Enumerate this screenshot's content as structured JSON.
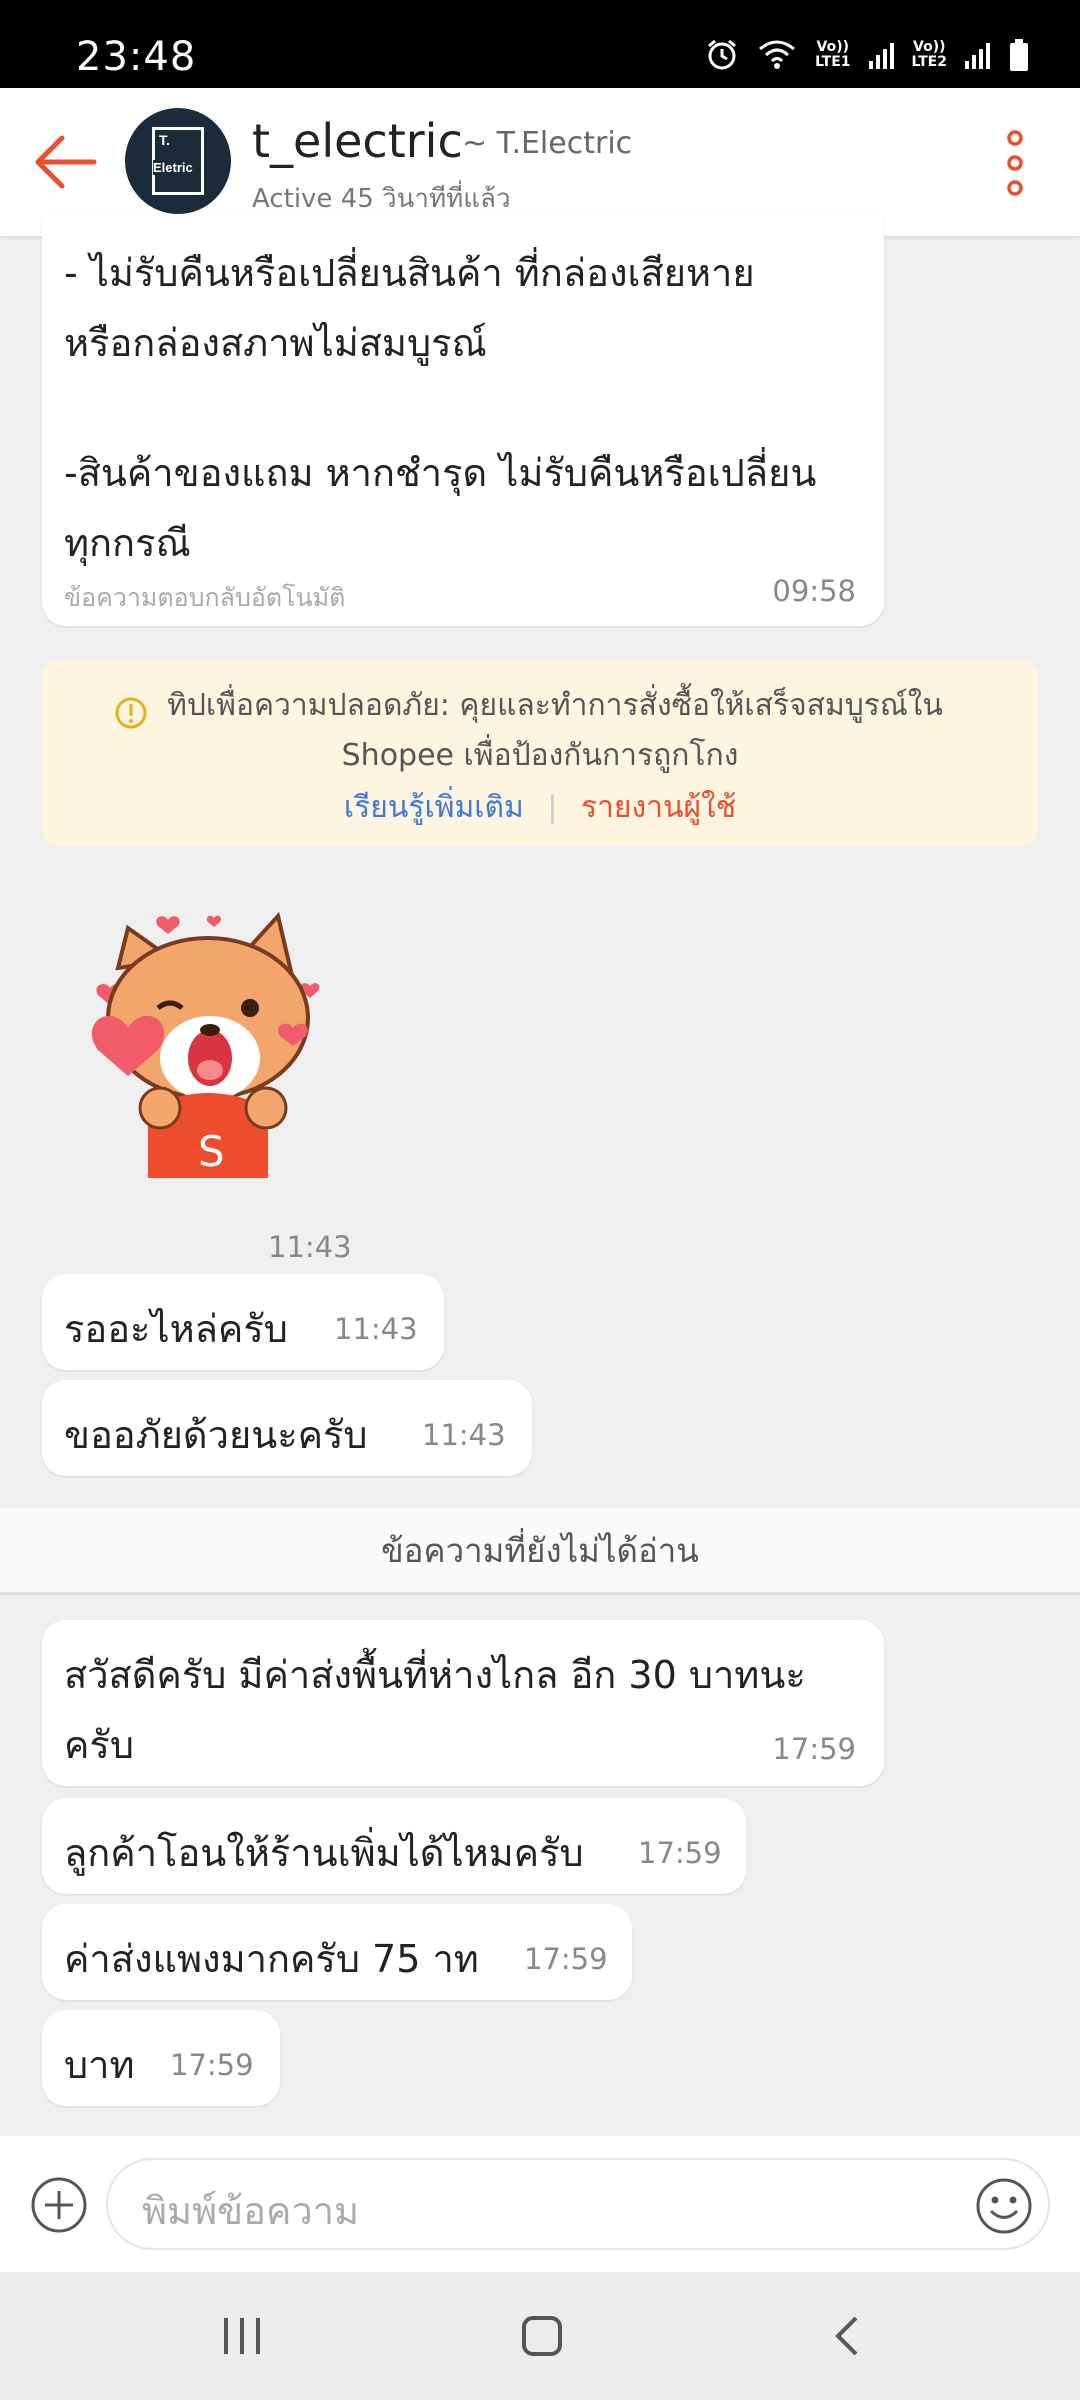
{
  "status_bar": {
    "time": "23:48",
    "sim1": "LTE1",
    "sim2": "LTE2",
    "volte": "Vo))",
    "icons": [
      "alarm-icon",
      "wifi-icon",
      "signal-icon",
      "battery-icon"
    ]
  },
  "header": {
    "shop_name": "t_electric",
    "shop_alias": "~ T.Electric",
    "active_status": "Active 45 วินาทีที่แล้ว",
    "logo_text_top": "T.",
    "logo_text_bottom": "Eletric"
  },
  "messages": {
    "auto_reply": {
      "line1": "- ไม่รับคืนหรือเปลี่ยนสินค้า ที่กล่องเสียหาย",
      "line2": "หรือกล่องสภาพไม่สมบูรณ์",
      "line3": "-สินค้าของแถม หากชำรุด ไม่รับคืนหรือเปลี่ยน",
      "line4": "ทุกกรณี",
      "footer": "ข้อความตอบกลับอัตโนมัติ",
      "time": "09:58"
    },
    "sticker_time": "11:43",
    "sticker_letter": "S",
    "m1": {
      "text": "รออะไหล่ครับ",
      "time": "11:43"
    },
    "m2": {
      "text": "ขออภัยด้วยนะครับ",
      "time": "11:43"
    },
    "unread_divider": "ข้อความที่ยังไม่ได้อ่าน",
    "m3": {
      "line1": "สวัสดีครับ มีค่าส่งพื้นที่ห่างไกล อีก 30 บาทนะ",
      "line2": "ครับ",
      "time": "17:59"
    },
    "m4": {
      "text": "ลูกค้าโอนให้ร้านเพิ่มได้ไหมครับ",
      "time": "17:59"
    },
    "m5": {
      "text": "ค่าส่งแพงมากครับ 75 าท",
      "time": "17:59"
    },
    "m6": {
      "text": "บาท",
      "time": "17:59"
    }
  },
  "safety_tip": {
    "line1": "ทิปเพื่อความปลอดภัย: คุยและทำการสั่งซื้อให้เสร็จสมบูรณ์ใน",
    "line2": "Shopee เพื่อป้องกันการถูกโกง",
    "learn_more": "เรียนรู้เพิ่มเติม",
    "report": "รายงานผู้ใช้"
  },
  "input": {
    "placeholder": "พิมพ์ข้อความ"
  },
  "colors": {
    "accent": "#ee4d2d",
    "link_blue": "#3b78d8",
    "tip_bg": "#fdf5e0"
  }
}
